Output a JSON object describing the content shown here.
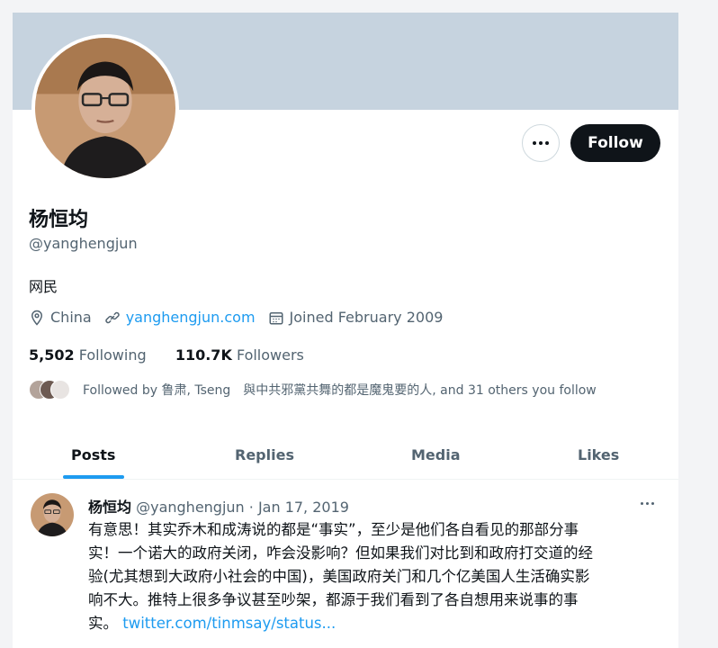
{
  "profile": {
    "display_name": "杨恒均",
    "handle": "@yanghengjun",
    "bio": "网民",
    "location": "China",
    "website": "yanghengjun.com",
    "joined": "Joined February 2009",
    "following_count": "5,502",
    "following_label": "Following",
    "followers_count": "110.7K",
    "followers_label": "Followers",
    "followed_by": "Followed by 鲁肃, Tseng　與中共邪黨共舞的都是魔鬼要的人, and 31 others you follow"
  },
  "actions": {
    "follow_label": "Follow"
  },
  "tabs": [
    "Posts",
    "Replies",
    "Media",
    "Likes"
  ],
  "tweet": {
    "author": "杨恒均",
    "meta": " @yanghengjun · Jan 17, 2019",
    "lines": [
      "有意思！其实乔木和成涛说的都是“事实”，至少是他们各自看见的那部分事",
      "实！一个诺大的政府关闭，咋会没影响？但如果我们对比到和政府打交道的经",
      "验(尤其想到大政府小社会的中国)，美国政府关门和几个亿美国人生活确实影",
      "响不大。推特上很多争议甚至吵架，都源于我们看到了各自想用来说事的事"
    ],
    "last_line_prefix": "实。",
    "link": "twitter.com/tinmsay/status..."
  },
  "colors": {
    "banner": "#c6d3df",
    "accent": "#1d9bf0",
    "text": "#0f1419",
    "muted": "#536471"
  },
  "icons": [
    "more-horizontal-icon",
    "location-pin-icon",
    "link-icon",
    "calendar-icon"
  ]
}
